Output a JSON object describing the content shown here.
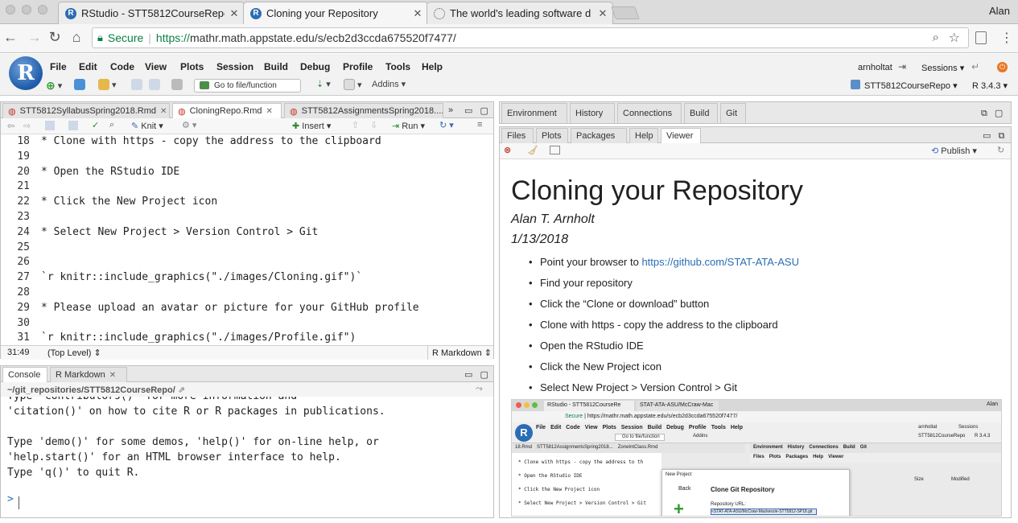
{
  "browser": {
    "tabs": [
      {
        "title": "RStudio - STT5812CourseRepo",
        "icon": "r-logo-icon",
        "active": false
      },
      {
        "title": "Cloning your Repository",
        "icon": "r-logo-icon",
        "active": true
      },
      {
        "title": "The world's leading software d",
        "icon": "github-icon",
        "active": false
      }
    ],
    "user": "Alan",
    "secure_label": "Secure",
    "url_scheme": "https://",
    "url_rest": "mathr.math.appstate.edu/s/ecb2d3ccda675520f7477/"
  },
  "rstudio": {
    "logo_letter": "R",
    "menu": [
      "File",
      "Edit",
      "Code",
      "View",
      "Plots",
      "Session",
      "Build",
      "Debug",
      "Profile",
      "Tools",
      "Help"
    ],
    "toolbar": {
      "goto_placeholder": "Go to file/function",
      "addins": "Addins"
    },
    "user": "arnholtat",
    "sessions": "Sessions",
    "project": "STT5812CourseRepo",
    "r_version": "R 3.4.3"
  },
  "editor": {
    "tabs": [
      "STT5812SyllabusSpring2018.Rmd",
      "CloningRepo.Rmd",
      "STT5812AssignmentsSpring2018...."
    ],
    "toolbar": {
      "knit": "Knit",
      "insert": "Insert",
      "run": "Run"
    },
    "lines": [
      {
        "n": "18",
        "text": "* Clone with https - copy the address to the clipboard"
      },
      {
        "n": "19",
        "text": ""
      },
      {
        "n": "20",
        "text": "* Open the RStudio IDE"
      },
      {
        "n": "21",
        "text": ""
      },
      {
        "n": "22",
        "text": "* Click the New Project icon"
      },
      {
        "n": "23",
        "text": ""
      },
      {
        "n": "24",
        "text": "* Select New Project > Version Control > Git"
      },
      {
        "n": "25",
        "text": ""
      },
      {
        "n": "26",
        "text": ""
      },
      {
        "n": "27",
        "text": "`r knitr::include_graphics(\"./images/Cloning.gif\")`"
      },
      {
        "n": "28",
        "text": ""
      },
      {
        "n": "29",
        "text": "* Please upload an avatar or picture for your GitHub profile"
      },
      {
        "n": "30",
        "text": ""
      },
      {
        "n": "31",
        "text": "`r knitr::include_graphics(\"./images/Profile.gif\")"
      }
    ],
    "status": {
      "position": "31:49",
      "scope": "(Top Level)",
      "mode": "R Markdown"
    }
  },
  "console": {
    "tabs": [
      "Console",
      "R Markdown"
    ],
    "path": "~/git_repositories/STT5812CourseRepo/",
    "lines": [
      "Type 'contributors()' for more information and",
      "'citation()' on how to cite R or R packages in publications.",
      "",
      "Type 'demo()' for some demos, 'help()' for on-line help, or",
      "'help.start()' for an HTML browser interface to help.",
      "Type 'q()' to quit R."
    ],
    "prompt": ">"
  },
  "env_pane": {
    "tabs": [
      "Environment",
      "History",
      "Connections",
      "Build",
      "Git"
    ]
  },
  "viewer_pane": {
    "tabs": [
      "Files",
      "Plots",
      "Packages",
      "Help",
      "Viewer"
    ],
    "publish": "Publish",
    "title": "Cloning your Repository",
    "author": "Alan T. Arnholt",
    "date": "1/13/2018",
    "bullets": [
      {
        "text": "Point your browser to ",
        "link": "https://github.com/STAT-ATA-ASU"
      },
      {
        "text": "Find your repository",
        "link": ""
      },
      {
        "text": "Click the “Clone or download” button",
        "link": ""
      },
      {
        "text": "Clone with https - copy the address to the clipboard",
        "link": ""
      },
      {
        "text": "Open the RStudio IDE",
        "link": ""
      },
      {
        "text": "Click the New Project icon",
        "link": ""
      },
      {
        "text": "Select New Project > Version Control > Git",
        "link": ""
      }
    ],
    "embedded": {
      "tabs": [
        "RStudio - STT5812CourseRe",
        "STAT-ATA-ASU/McCraw-Mac"
      ],
      "user": "Alan",
      "secure": "Secure",
      "url": "https://mathr.math.appstate.edu/s/ecb2d3ccda675520f7477/",
      "menu": [
        "File",
        "Edit",
        "Code",
        "View",
        "Plots",
        "Session",
        "Build",
        "Debug",
        "Profile",
        "Tools",
        "Help"
      ],
      "goto": "Go to file/function",
      "addins": "Addins",
      "user2": "arnholtat",
      "sessions": "Sessions",
      "project": "STT5812CourseRepo",
      "r_version": "R 3.4.3",
      "editor_tabs": [
        "18.Rmd",
        "STT5812AssignmentsSpring2018...",
        "ZoneIntClass.Rmd"
      ],
      "env_tabs": [
        "Environment",
        "History",
        "Connections",
        "Build",
        "Git"
      ],
      "files_tabs": [
        "Files",
        "Plots",
        "Packages",
        "Help",
        "Viewer"
      ],
      "code": [
        "* Clone with https - copy the address to th",
        "* Open the RStudio IDE",
        "* Click the New Project icon",
        "* Select New Project > Version Control > Git"
      ],
      "dialog_title": "New Project",
      "dialog_back": "Back",
      "dialog_heading": "Clone Git Repository",
      "dialog_url_label": "Repository URL:",
      "dialog_url_value": "<STAT-ATA-ASU/McCraw-Mackenzie-STT5812-SP18.git",
      "size_label": "Size",
      "modified_label": "Modified"
    }
  }
}
